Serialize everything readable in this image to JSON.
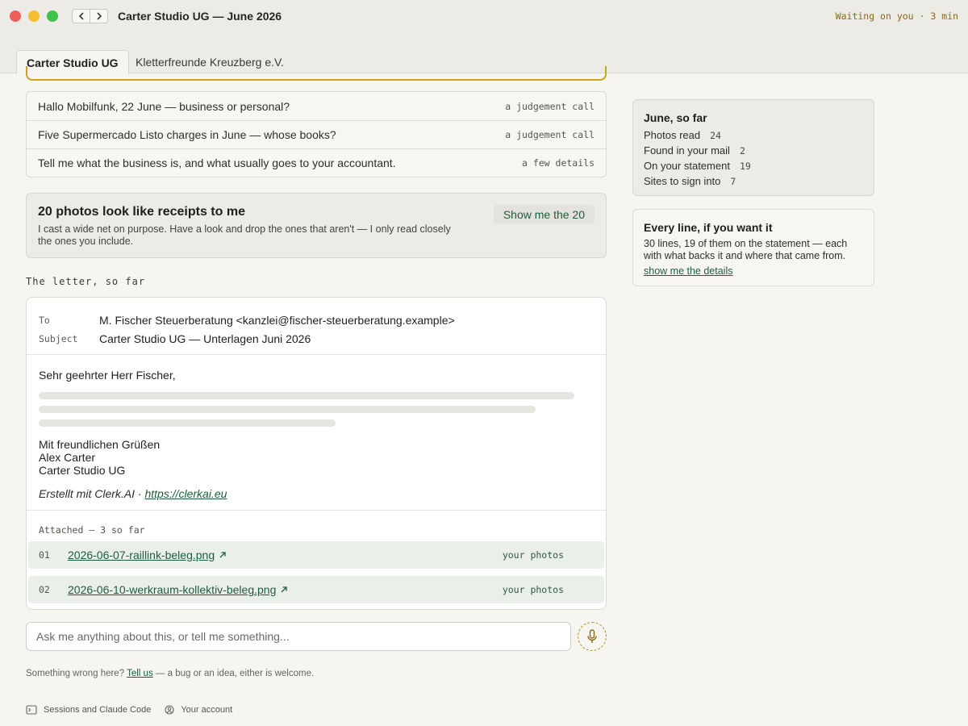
{
  "window": {
    "title": "Carter Studio UG — June 2026",
    "status": "Waiting on you · 3 min"
  },
  "tabs": [
    {
      "label": "Carter Studio UG"
    },
    {
      "label": "Kletterfreunde Kreuzberg e.V."
    }
  ],
  "questions": [
    {
      "text": "Hallo Mobilfunk, 22 June — business or personal?",
      "tag": "a judgement call"
    },
    {
      "text": "Five Supermercado Listo charges in June — whose books?",
      "tag": "a judgement call"
    },
    {
      "text": "Tell me what the business is, and what usually goes to your accountant.",
      "tag": "a few details"
    }
  ],
  "receipts": {
    "title": "20 photos look like receipts to me",
    "description": "I cast a wide net on purpose. Have a look and drop the ones that aren't — I only read closely the ones you include.",
    "button": "Show me the 20"
  },
  "letter": {
    "section_label": "The letter, so far",
    "to_label": "To",
    "to_value": "M. Fischer Steuerberatung <kanzlei@fischer-steuerberatung.example>",
    "subject_label": "Subject",
    "subject_value": "Carter Studio UG — Unterlagen Juni 2026",
    "greeting": "Sehr geehrter Herr Fischer,",
    "closing": "Mit freundlichen Grüßen",
    "sender_name": "Alex Carter",
    "sender_company": "Carter Studio UG",
    "made_with": "Erstellt mit Clerk.AI ·",
    "made_with_link": "https://clerkai.eu",
    "attached_label": "Attached — 3 so far",
    "attachments": [
      {
        "num": "01",
        "name": "2026-06-07-raillink-beleg.png",
        "source": "your photos"
      },
      {
        "num": "02",
        "name": "2026-06-10-werkraum-kollektiv-beleg.png",
        "source": "your photos"
      }
    ]
  },
  "ask": {
    "placeholder": "Ask me anything about this, or tell me something..."
  },
  "feedback": {
    "prefix": "Something wrong here?",
    "link": "Tell us",
    "suffix": "— a bug or an idea, either is welcome."
  },
  "footer": {
    "sessions": "Sessions and Claude Code",
    "account": "Your account"
  },
  "stats": {
    "title": "June, so far",
    "rows": [
      {
        "label": "Photos read",
        "value": "24"
      },
      {
        "label": "Found in your mail",
        "value": "2"
      },
      {
        "label": "On your statement",
        "value": "19"
      },
      {
        "label": "Sites to sign into",
        "value": "7"
      }
    ]
  },
  "every_line": {
    "title": "Every line, if you want it",
    "text": "30 lines, 19 of them on the statement — each with what backs it and where that came from.",
    "link": "show me the details"
  },
  "colors": {
    "accent_green": "#1f5c3c",
    "accent_gold": "#c8a61a",
    "background": "#f6f5f1"
  }
}
